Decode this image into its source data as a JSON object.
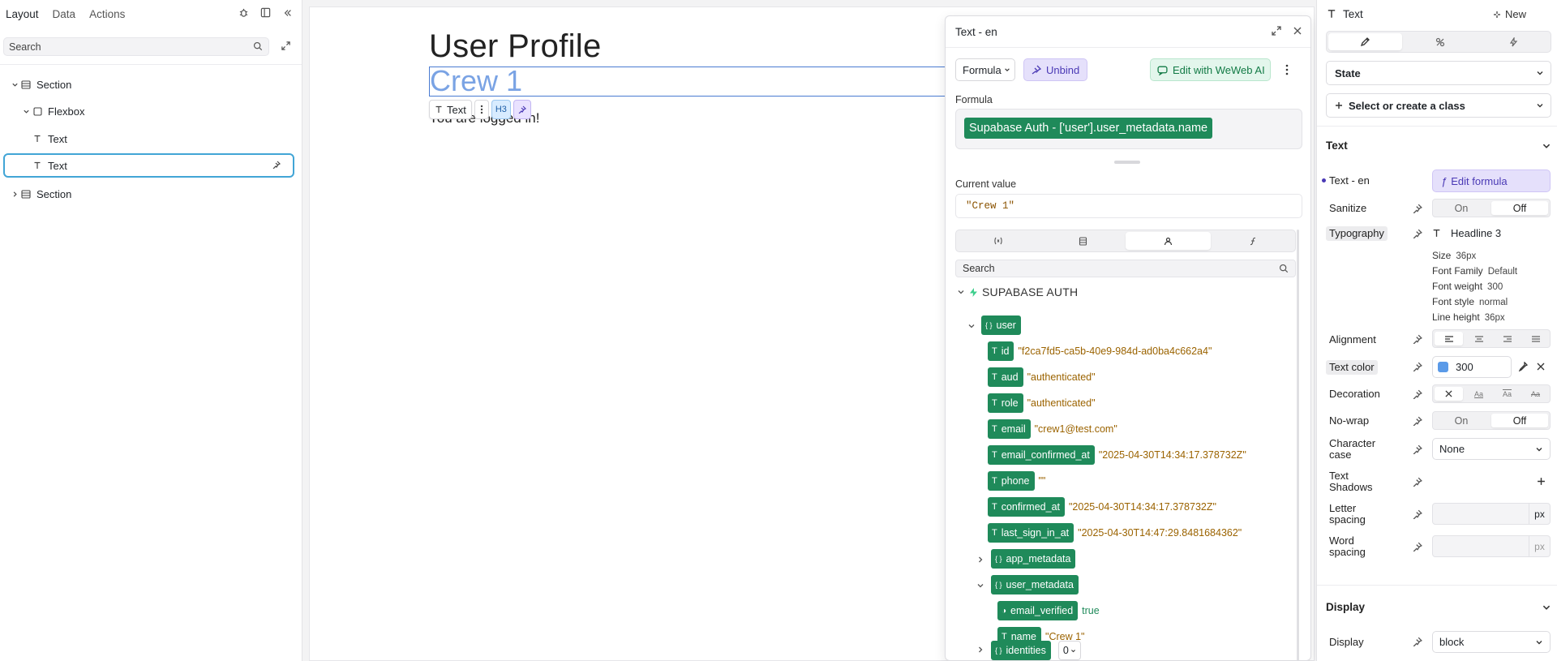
{
  "left_panel": {
    "tabs": [
      "Layout",
      "Data",
      "Actions"
    ],
    "search_placeholder": "Search",
    "tree": [
      {
        "label": "Section",
        "type": "section",
        "expanded": true,
        "depth": 0
      },
      {
        "label": "Flexbox",
        "type": "flexbox",
        "expanded": true,
        "depth": 1
      },
      {
        "label": "Text",
        "type": "text",
        "depth": 2
      },
      {
        "label": "Text",
        "type": "text",
        "depth": 2,
        "selected": true
      },
      {
        "label": "Section",
        "type": "section",
        "expanded": false,
        "depth": 0
      }
    ]
  },
  "canvas": {
    "title": "User Profile",
    "selected_text": "Crew 1",
    "subtext": "You are logged in!",
    "toolbar": {
      "label": "Text",
      "heading": "H3"
    }
  },
  "formula_popup": {
    "title": "Text - en",
    "formula_button": "Formula",
    "unbind_button": "Unbind",
    "ai_button": "Edit with WeWeb AI",
    "formula_label": "Formula",
    "formula_value": "Supabase Auth - ['user'].user_metadata.name",
    "current_value_label": "Current value",
    "current_value": "\"Crew 1\"",
    "search_placeholder": "Search",
    "tree_title": "SUPABASE AUTH",
    "user_node": "user",
    "user_fields": [
      {
        "key": "id",
        "value": "\"f2ca7fd5-ca5b-40e9-984d-ad0ba4c662a4\""
      },
      {
        "key": "aud",
        "value": "\"authenticated\""
      },
      {
        "key": "role",
        "value": "\"authenticated\""
      },
      {
        "key": "email",
        "value": "\"crew1@test.com\""
      },
      {
        "key": "email_confirmed_at",
        "value": "\"2025-04-30T14:34:17.378732Z\""
      },
      {
        "key": "phone",
        "value": "\"\""
      },
      {
        "key": "confirmed_at",
        "value": "\"2025-04-30T14:34:17.378732Z\""
      },
      {
        "key": "last_sign_in_at",
        "value": "\"2025-04-30T14:47:29.8481684362\""
      }
    ],
    "app_metadata": "app_metadata",
    "user_metadata": "user_metadata",
    "user_metadata_fields": [
      {
        "key": "email_verified",
        "value": "true"
      },
      {
        "key": "name",
        "value": "\"Crew 1\""
      }
    ],
    "identities": "identities",
    "identities_count": "0"
  },
  "right_panel": {
    "title": "Text",
    "new_button": "New",
    "state_label": "State",
    "class_label": "Select or create a class",
    "text_section": "Text",
    "text_en_label": "Text - en",
    "edit_formula": "Edit formula",
    "sanitize_label": "Sanitize",
    "on": "On",
    "off": "Off",
    "typography_label": "Typography",
    "typography_value": "Headline 3",
    "typo_details": [
      {
        "k": "Size",
        "v": "36px"
      },
      {
        "k": "Font Family",
        "v": "Default"
      },
      {
        "k": "Font weight",
        "v": "300"
      },
      {
        "k": "Font style",
        "v": "normal"
      },
      {
        "k": "Line height",
        "v": "36px"
      }
    ],
    "alignment_label": "Alignment",
    "text_color_label": "Text color",
    "text_color_value": "300",
    "text_color_swatch": "#5a9ae8",
    "decoration_label": "Decoration",
    "decoration_options": [
      "Aa",
      "Aa",
      "Aa"
    ],
    "nowrap_label": "No-wrap",
    "char_case_label": "Character case",
    "char_case_value": "None",
    "text_shadows_label": "Text Shadows",
    "letter_spacing_label": "Letter spacing",
    "word_spacing_label": "Word spacing",
    "unit_px": "px",
    "display_section": "Display",
    "display_label": "Display",
    "display_value": "block"
  }
}
